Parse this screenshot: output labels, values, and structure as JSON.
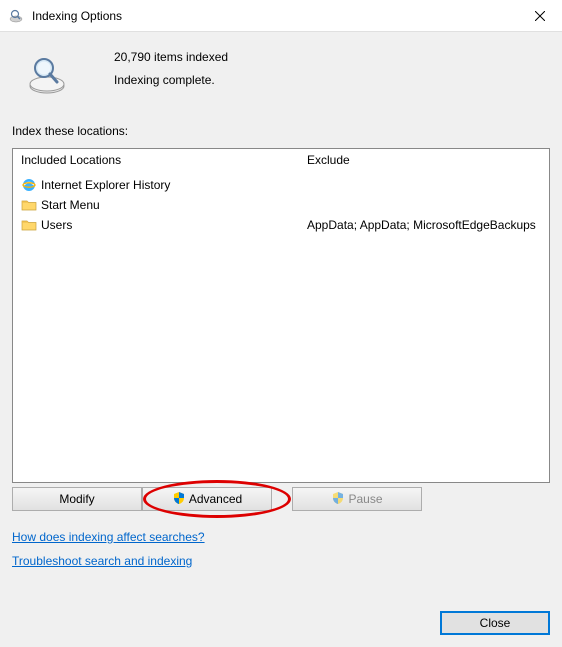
{
  "window": {
    "title": "Indexing Options"
  },
  "status": {
    "count_text": "20,790 items indexed",
    "state_text": "Indexing complete."
  },
  "section_label": "Index these locations:",
  "columns": {
    "included_header": "Included Locations",
    "exclude_header": "Exclude"
  },
  "locations": [
    {
      "name": "Internet Explorer History",
      "icon": "ie",
      "exclude": ""
    },
    {
      "name": "Start Menu",
      "icon": "folder",
      "exclude": ""
    },
    {
      "name": "Users",
      "icon": "folder",
      "exclude": "AppData; AppData; MicrosoftEdgeBackups"
    }
  ],
  "buttons": {
    "modify": "Modify",
    "advanced": "Advanced",
    "pause": "Pause",
    "close": "Close"
  },
  "links": {
    "how": "How does indexing affect searches?",
    "troubleshoot": "Troubleshoot search and indexing"
  }
}
